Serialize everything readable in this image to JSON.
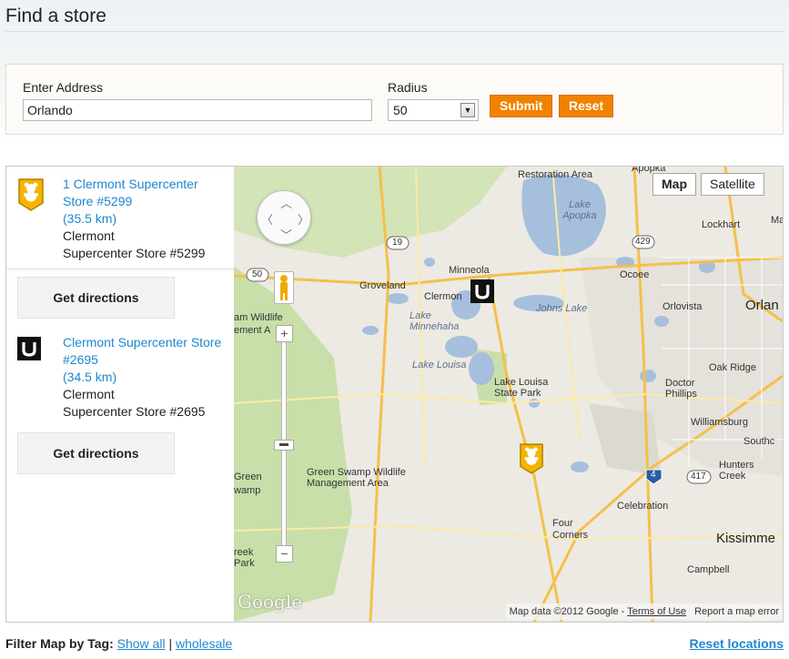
{
  "page": {
    "title": "Find a store"
  },
  "search": {
    "address_label": "Enter Address",
    "address_value": "Orlando",
    "radius_label": "Radius",
    "radius_value": "50",
    "submit_label": "Submit",
    "reset_label": "Reset"
  },
  "stores": [
    {
      "name": "1 Clermont Supercenter Store #5299",
      "distance": "(35.5 km)",
      "address_line1": "Clermont",
      "address_line2": "Supercenter Store #5299",
      "directions_label": "Get directions",
      "icon": "teddy-bear-icon"
    },
    {
      "name": "Clermont Supercenter Store #2695",
      "distance": "(34.5 km)",
      "address_line1": "Clermont",
      "address_line2": "Supercenter Store #2695",
      "directions_label": "Get directions",
      "icon": "u-logo-icon"
    }
  ],
  "map": {
    "type_map": "Map",
    "type_satellite": "Satellite",
    "logo": "Google",
    "attribution": "Map data ©2012 Google - ",
    "terms": "Terms of Use",
    "report": "Report a map error",
    "labels": {
      "restoration_area": "Restoration Area",
      "lake_apopka": "Lake Apopka",
      "lockhart": "Lockhart",
      "ma": "Ma",
      "minneola": "Minneola",
      "ocoee": "Ocoee",
      "groveland": "Groveland",
      "clermont": "Clermon",
      "johns_lake": "Johns Lake",
      "orlovista": "Orlovista",
      "orlando": "Orlan",
      "lake_minnehaha": "Lake Minnehaha",
      "wildlife": "am Wildlife",
      "management": "ement A",
      "lake_louisa": "Lake Louisa",
      "lake_louisa_park": "Lake Louisa State Park",
      "oak_ridge": "Oak Ridge",
      "doctor_phillips": "Doctor Phillips",
      "williamsburg": "Williamsburg",
      "southchase": "Southc",
      "hunters_creek": "Hunters Creek",
      "green_swamp_left": "Green wamp",
      "green_swamp_wma": "Green Swamp Wildlife Management Area",
      "celebration": "Celebration",
      "four_corners": "Four Corners",
      "kissimmee": "Kissimme",
      "reek_park": "reek Park",
      "campbell": "Campbell",
      "apopka_top": "Apopka"
    },
    "shields": {
      "r19": "19",
      "r429": "429",
      "r50": "50",
      "r4": "4",
      "r417": "417"
    }
  },
  "footer": {
    "filter_label": "Filter Map by Tag:",
    "show_all": "Show all",
    "separator": "|",
    "wholesale": "wholesale",
    "reset_locations": "Reset locations"
  },
  "colors": {
    "accent_orange": "#f18200",
    "link_blue": "#1f86d0",
    "marker_yellow": "#f4b400",
    "water": "#a5bfdd",
    "park_green": "#c8dfa9"
  }
}
